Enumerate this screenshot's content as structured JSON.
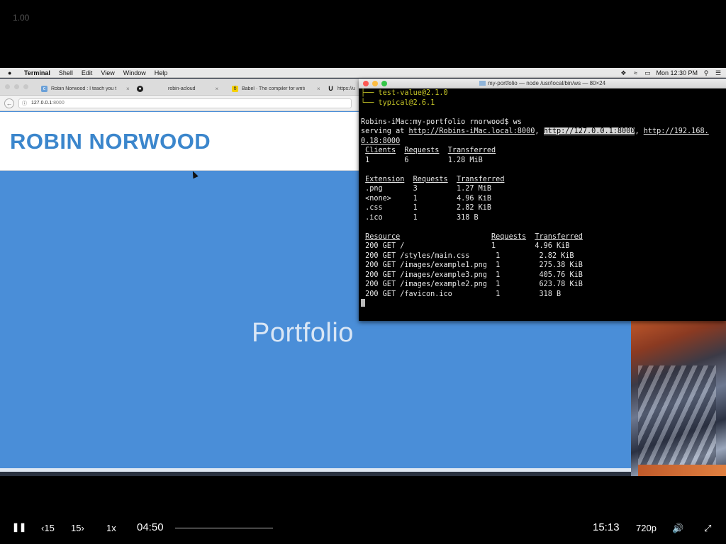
{
  "player": {
    "speed_overlay": "1.00",
    "rewind_label": "15",
    "forward_label": "15",
    "speed_label": "1x",
    "current_time": "04:50",
    "total_time": "15:13",
    "quality": "720p",
    "progress_fraction": 0.0
  },
  "menubar": {
    "app_name": "Terminal",
    "items": [
      "Shell",
      "Edit",
      "View",
      "Window",
      "Help"
    ],
    "clock": "Mon 12:30 PM"
  },
  "browser": {
    "tabs": [
      {
        "label": "Robin Norwood : I teach you t",
        "icon": "cg-favicon"
      },
      {
        "label": "robin-acloud",
        "icon": "github-icon"
      },
      {
        "label": "Babel · The compiler for writi",
        "icon": "babel-icon"
      },
      {
        "label": "https://u",
        "icon": "u-icon"
      }
    ],
    "url_host": "127.0.0.1",
    "url_port": ":8000",
    "site_title": "ROBIN NORWOOD",
    "hero_title": "Portfolio"
  },
  "terminal": {
    "title": "my-portfolio — node /usr/local/bin/ws — 80×24",
    "tree_lines": [
      "├── test-value@2.1.0",
      "└── typical@2.6.1"
    ],
    "prompt": "Robins-iMac:my-portfolio rnorwood$ ws",
    "serving_prefix": "serving at ",
    "url1": "http://Robins-iMac.local:8000",
    "url2": "http://127.0.0.1:8000",
    "url3a": "http://192.168.",
    "url3b": "0.18:8000",
    "clients_headers": [
      "Clients",
      "Requests",
      "Transferred"
    ],
    "clients_row": [
      "1",
      "6",
      "1.28 MiB"
    ],
    "ext_headers": [
      "Extension",
      "Requests",
      "Transferred"
    ],
    "ext_rows": [
      [
        ".png",
        "3",
        "1.27 MiB"
      ],
      [
        "<none>",
        "1",
        "4.96 KiB"
      ],
      [
        ".css",
        "1",
        "2.82 KiB"
      ],
      [
        ".ico",
        "1",
        "318 B"
      ]
    ],
    "res_headers": [
      "Resource",
      "Requests",
      "Transferred"
    ],
    "res_rows": [
      [
        "200 GET /",
        "1",
        "4.96 KiB"
      ],
      [
        "200 GET /styles/main.css",
        "1",
        "2.82 KiB"
      ],
      [
        "200 GET /images/example1.png",
        "1",
        "275.38 KiB"
      ],
      [
        "200 GET /images/example3.png",
        "1",
        "405.76 KiB"
      ],
      [
        "200 GET /images/example2.png",
        "1",
        "623.78 KiB"
      ],
      [
        "200 GET /favicon.ico",
        "1",
        "318 B"
      ]
    ]
  }
}
